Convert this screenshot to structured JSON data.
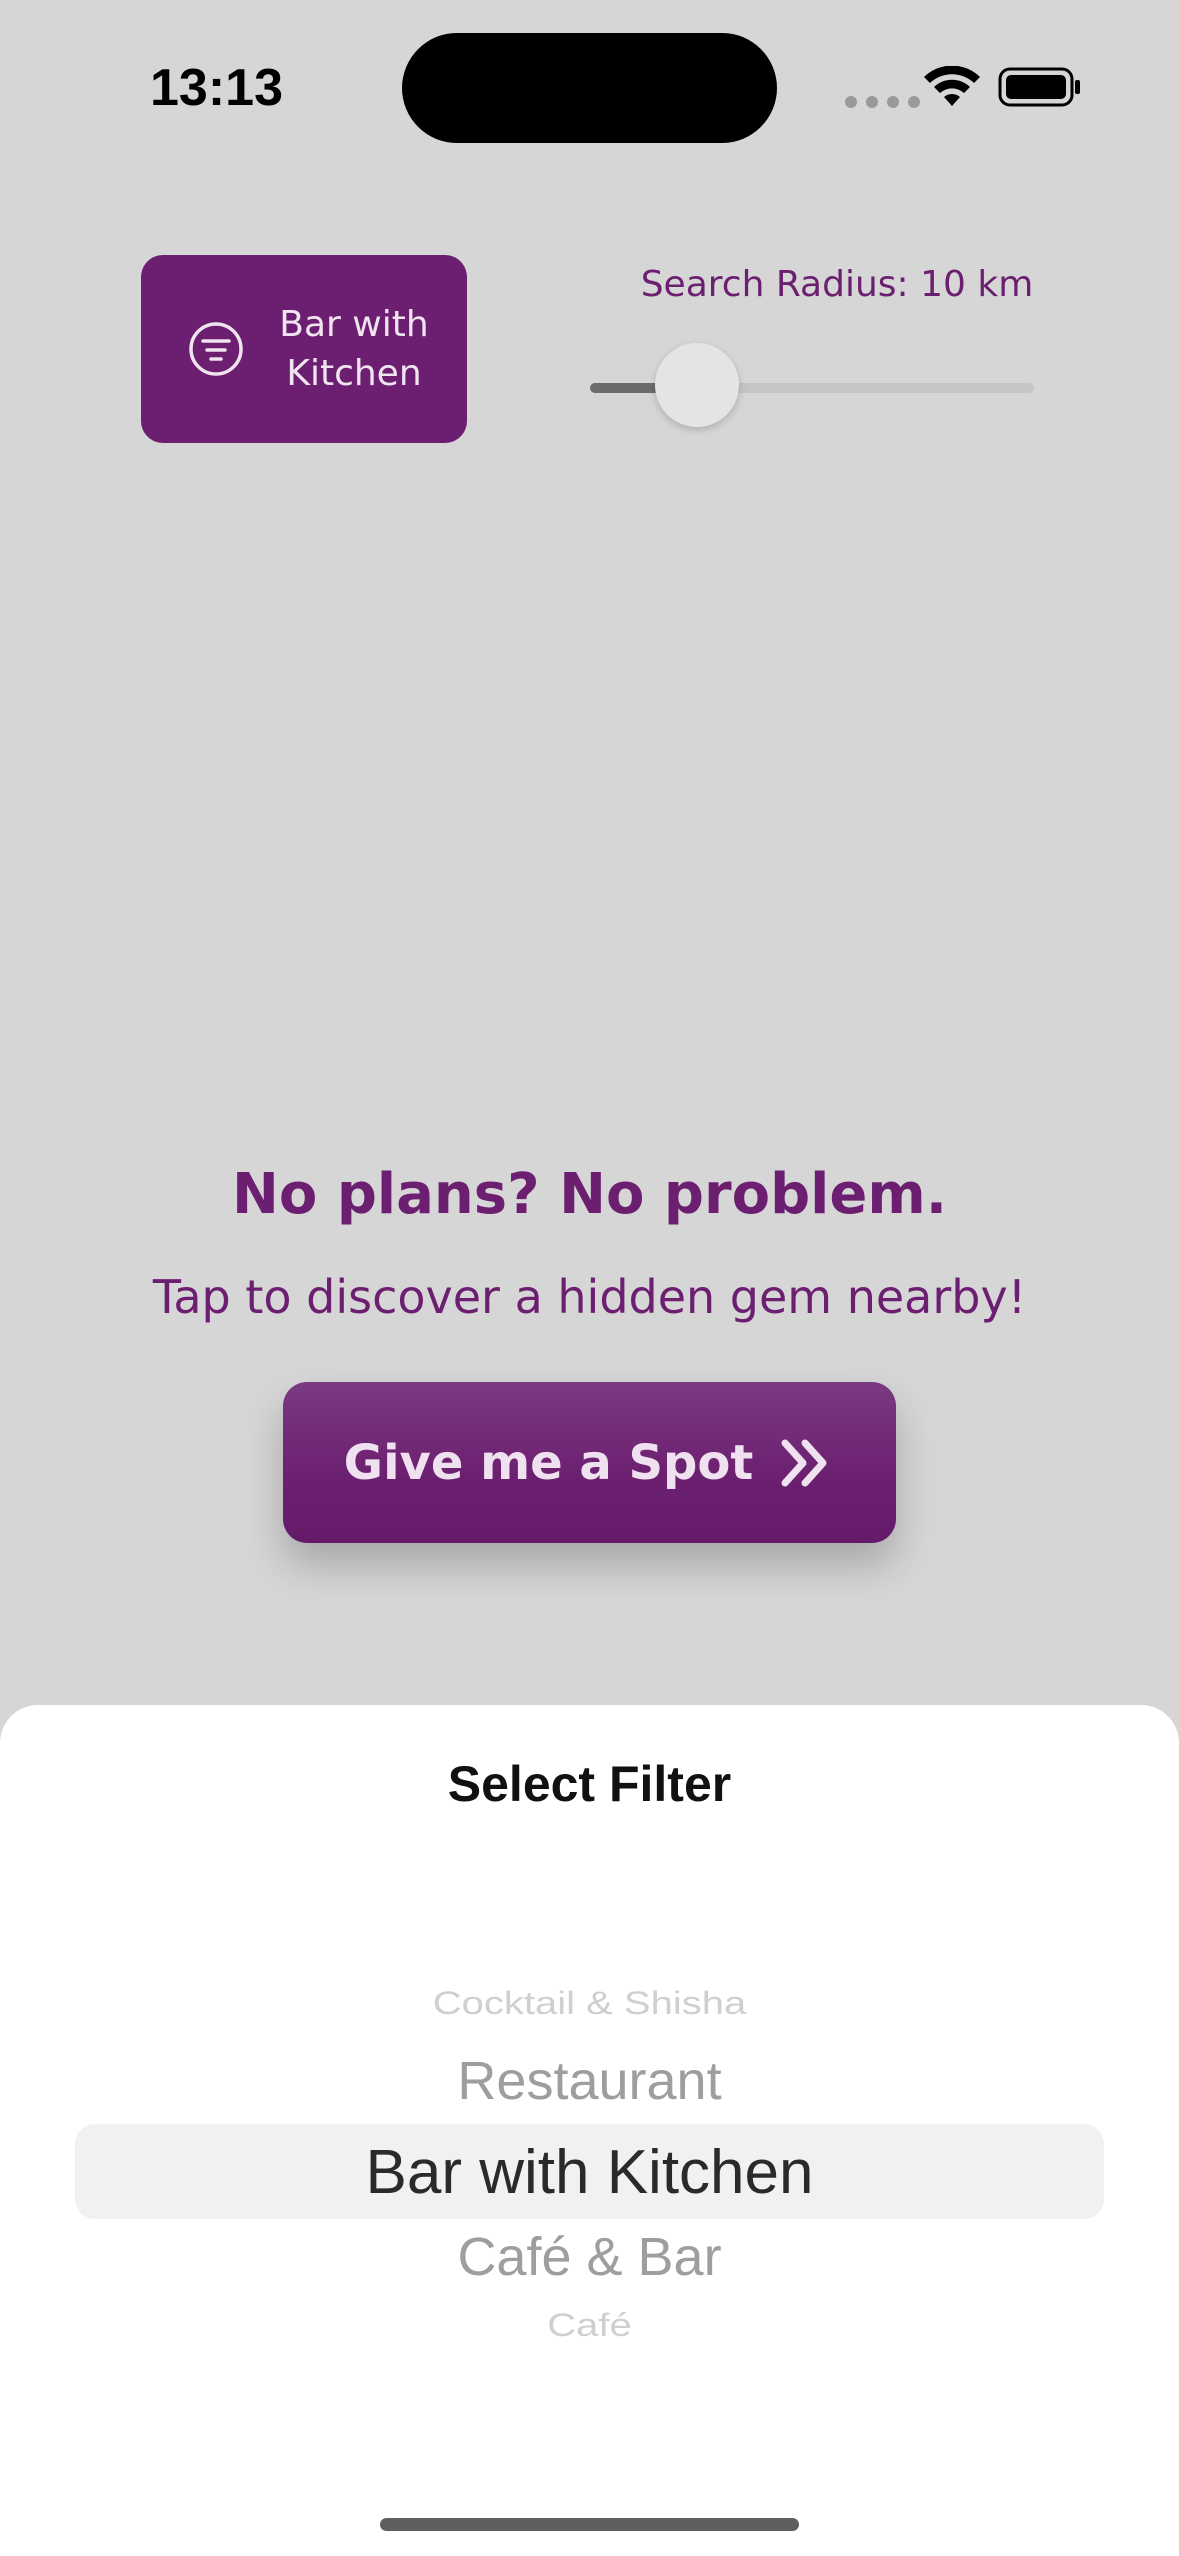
{
  "status_bar": {
    "time": "13:13"
  },
  "filter_button": {
    "label": "Bar with Kitchen",
    "icon": "filter-icon"
  },
  "search_radius": {
    "label": "Search Radius: 10 km",
    "fraction": 0.24
  },
  "hero": {
    "headline": "No plans? No problem.",
    "subline": "Tap to discover a hidden gem nearby!"
  },
  "cta": {
    "label": "Give me a Spot",
    "icon": "double-chevron-right-icon"
  },
  "sheet": {
    "title": "Select Filter",
    "picker": {
      "far_above": "Cocktail & Shisha",
      "above": "Restaurant",
      "selected": "Bar with Kitchen",
      "below": "Café & Bar",
      "far_below": "Café"
    }
  },
  "colors": {
    "brand": "#6c1f70",
    "background": "#d6d6d6",
    "sheet": "#ffffff"
  }
}
